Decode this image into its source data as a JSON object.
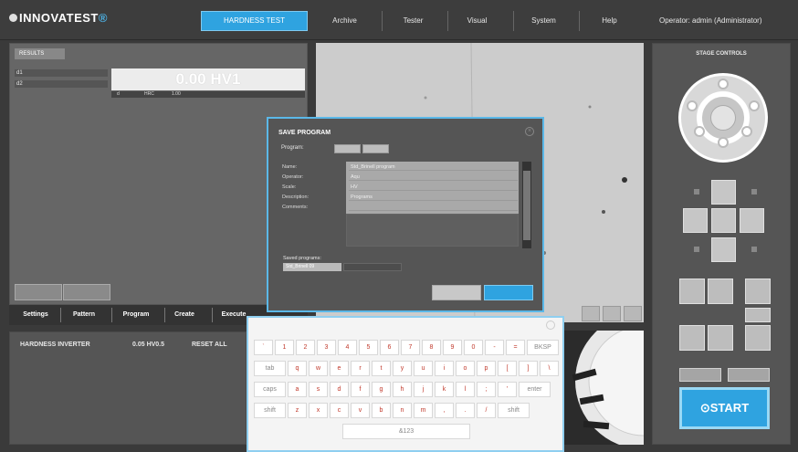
{
  "app": {
    "brand": "INNOVATEST",
    "mode_button": "HARDNESS TEST"
  },
  "menu": {
    "items": [
      "Archive",
      "Tester",
      "Visual",
      "System",
      "Help"
    ],
    "operator": "Operator: admin  (Administrator)"
  },
  "results": {
    "title": "RESULTS",
    "rows": [
      "d1",
      "d2"
    ],
    "value": "0.00 HV1",
    "sub": [
      "d",
      "HRC",
      "1.00"
    ]
  },
  "left_tabs": [
    "Settings",
    "Pattern",
    "Program",
    "Create",
    "Execute"
  ],
  "hardness": {
    "title": "HARDNESS INVERTER",
    "scale": "0.05 HV0.5",
    "reset": "RESET ALL"
  },
  "dialog": {
    "title": "SAVE PROGRAM",
    "program_label": "Program:",
    "fields": [
      "Name:",
      "Operator:",
      "Scale:",
      "Description:",
      "Comments:"
    ],
    "values": [
      "Std_Brinell program",
      "Aqu",
      "HV",
      "Programs"
    ],
    "saved_label": "Saved programs:",
    "saved_value": "Std_Brinell 09"
  },
  "keyboard": {
    "row1": [
      "`",
      "1",
      "2",
      "3",
      "4",
      "5",
      "6",
      "7",
      "8",
      "9",
      "0",
      "-",
      "=",
      "BKSP"
    ],
    "row2": [
      "tab",
      "q",
      "w",
      "e",
      "r",
      "t",
      "y",
      "u",
      "i",
      "o",
      "p",
      "[",
      "]",
      "\\"
    ],
    "row3": [
      "caps",
      "a",
      "s",
      "d",
      "f",
      "g",
      "h",
      "j",
      "k",
      "l",
      ";",
      "'",
      "enter"
    ],
    "row4": [
      "shift",
      "z",
      "x",
      "c",
      "v",
      "b",
      "n",
      "m",
      ",",
      ".",
      "/",
      "shift"
    ],
    "space_label": "&123"
  },
  "stage": {
    "title": "STAGE CONTROLS",
    "start": "START"
  },
  "colors": {
    "accent": "#2fa3e0",
    "panel": "#555555",
    "background": "#3a3a3a"
  }
}
